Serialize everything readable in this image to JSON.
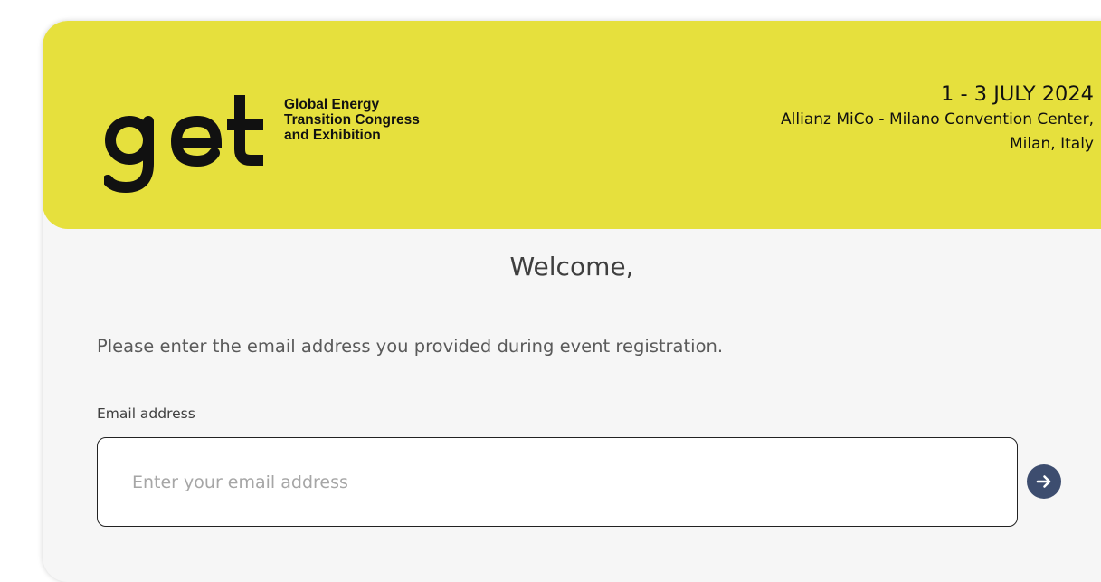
{
  "header": {
    "logo_text": "get",
    "tagline_lines": [
      "Global Energy",
      "Transition Congress",
      "and Exhibition"
    ],
    "event_date": "1 - 3 JULY 2024",
    "venue": "Allianz MiCo - Milano Convention Center,",
    "city": "Milan, Italy",
    "background_color": "#e6e03d"
  },
  "main": {
    "welcome": "Welcome,",
    "instructions": "Please enter the email address you provided during event registration.",
    "email_label": "Email address",
    "email_value": "",
    "email_placeholder": "Enter your email address",
    "submit_icon": "arrow-right-circle-icon",
    "submit_color": "#3d4d6f"
  }
}
